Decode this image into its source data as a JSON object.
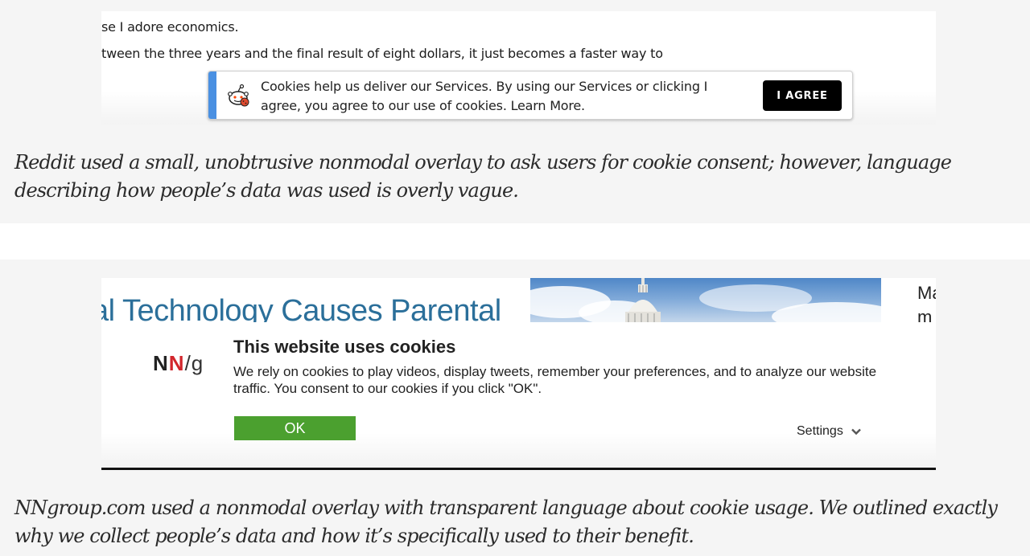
{
  "figure1": {
    "article_lines": [
      "se I adore economics.",
      "tween the three years and the final result of eight dollars, it just becomes a faster way to"
    ],
    "banner": {
      "icon": "reddit-snoo-cookie-icon",
      "message": "Cookies help us deliver our Services. By using our Services or clicking I agree, you agree to our use of cookies. Learn More.",
      "button_label": "I AGREE",
      "accent_color": "#4a90e2"
    },
    "caption": "Reddit used a small, unobtrusive nonmodal overlay to ask users for cookie consent; however, language describing how people’s data was used is overly vague."
  },
  "figure2": {
    "headline_fragment": "al Technology Causes Parental",
    "side_text": [
      "Ma",
      "m"
    ],
    "logo": {
      "part1": "N",
      "part2": "N",
      "part3": "/g"
    },
    "banner": {
      "title": "This website uses cookies",
      "body": "We rely on cookies to play videos, display tweets, remember your preferences, and to analyze our website traffic. You consent to our cookies if you click \"OK\".",
      "ok_label": "OK",
      "settings_label": "Settings",
      "ok_color": "#4ba02f"
    },
    "caption": "NNgroup.com used a nonmodal overlay with transparent language about cookie usage. We outlined exactly why we collect people’s data and how it’s specifically used to their benefit."
  }
}
